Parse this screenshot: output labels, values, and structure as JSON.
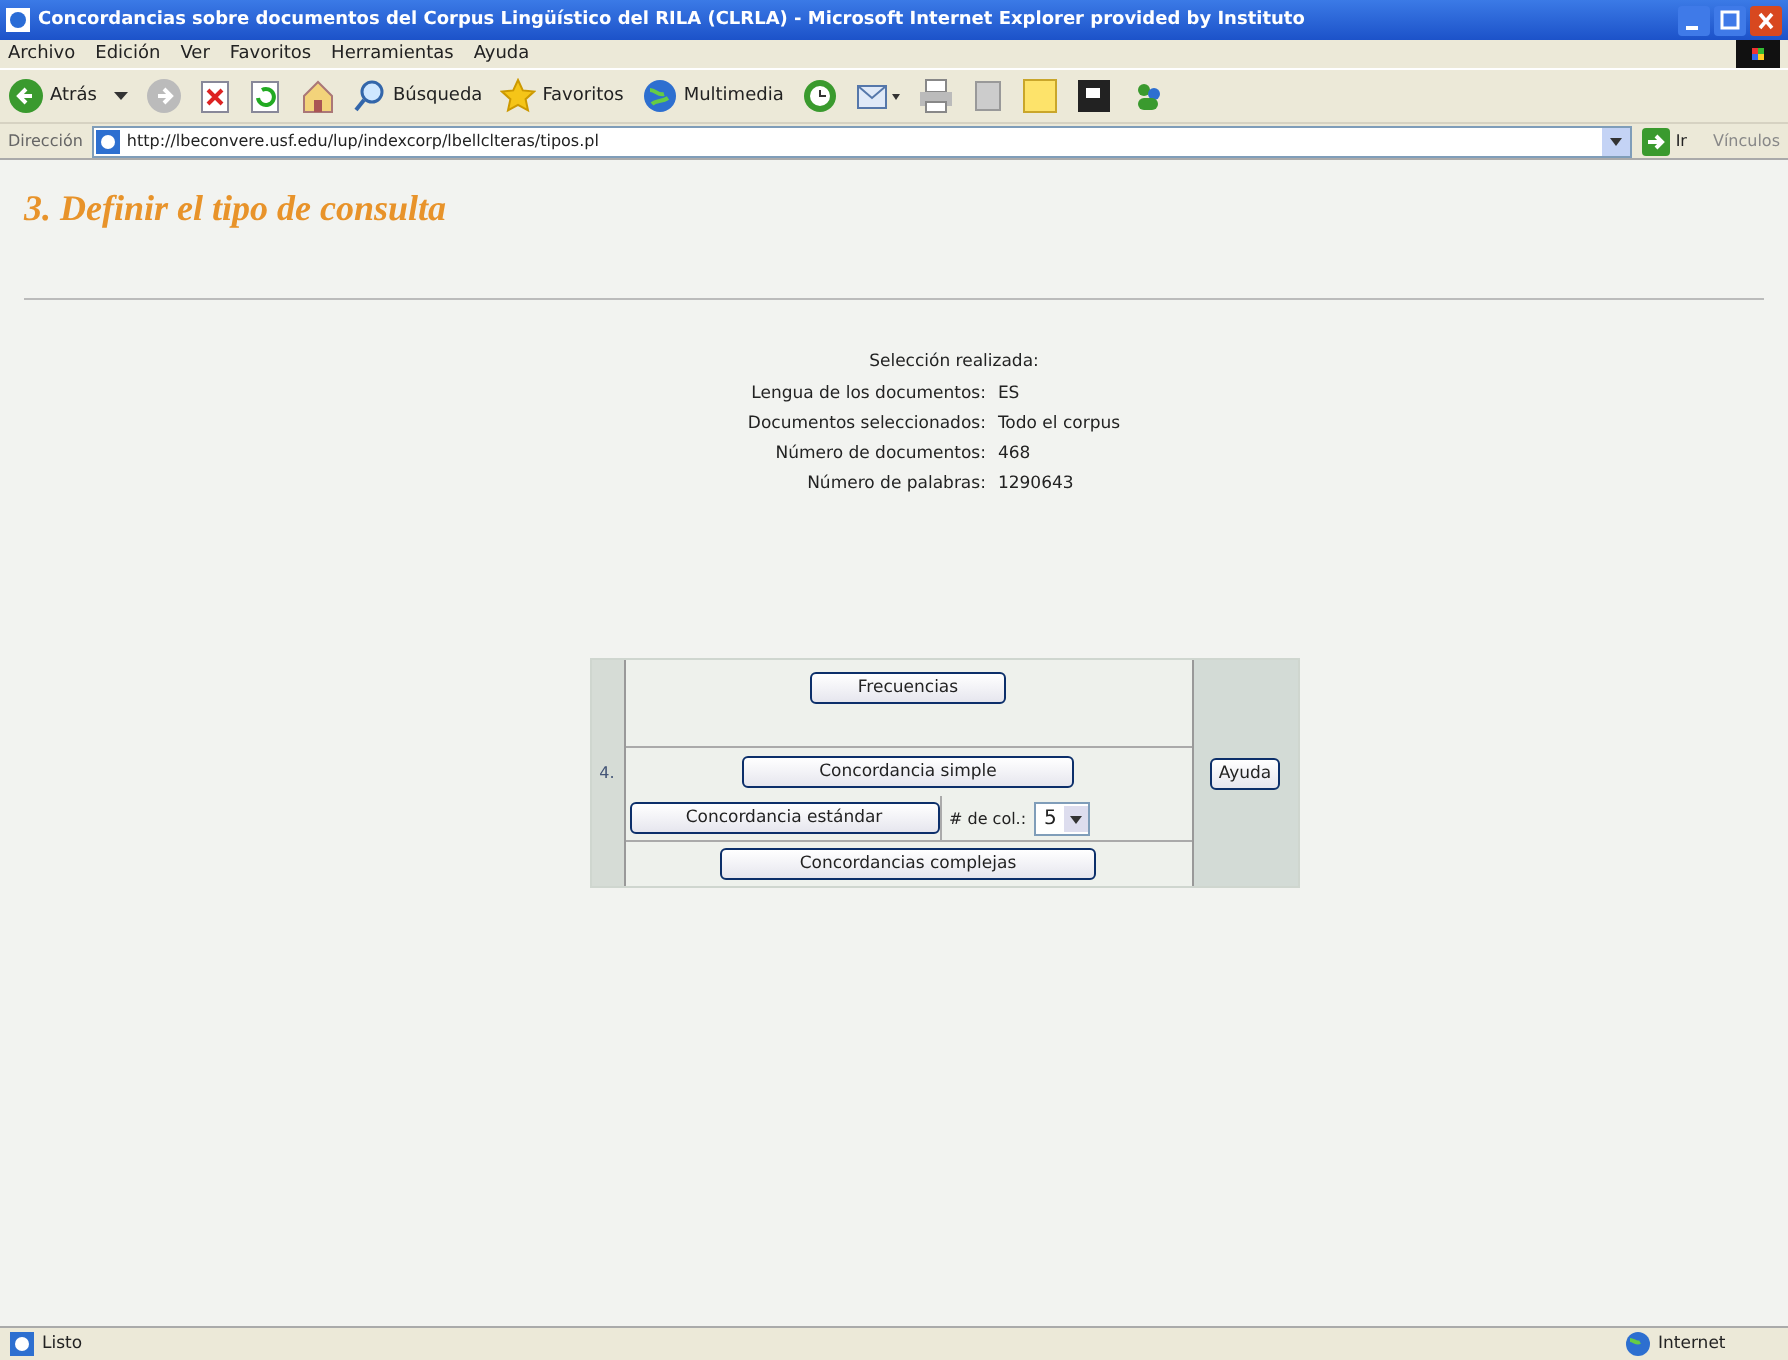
{
  "window": {
    "title": "Concordancias sobre documentos del Corpus Lingüístico del RILA (CLRLA) - Microsoft Internet Explorer provided by Instituto"
  },
  "menu": [
    "Archivo",
    "Edición",
    "Ver",
    "Favoritos",
    "Herramientas",
    "Ayuda"
  ],
  "toolbar": {
    "back": "Atrás",
    "search": "Búsqueda",
    "favorites": "Favoritos",
    "media": "Multimedia"
  },
  "address": {
    "label": "Dirección",
    "value": "http://lbeconvere.usf.edu/lup/indexcorp/lbellclteras/tipos.pl",
    "go": "Ir",
    "links": "Vínculos"
  },
  "page": {
    "number": "3.",
    "heading": "Definir el tipo de consulta",
    "selection_title": "Selección realizada:",
    "selection": [
      {
        "label": "Lengua de los documentos:",
        "value": "ES"
      },
      {
        "label": "Documentos seleccionados:",
        "value": "Todo el corpus"
      },
      {
        "label": "Número de documentos:",
        "value": "468"
      },
      {
        "label": "Número de palabras:",
        "value": "1290643"
      }
    ],
    "step": "4.",
    "buttons": {
      "frequencies": "Frecuencias",
      "simple": "Concordancia simple",
      "standard": "Concordancia estándar",
      "complex": "Concordancias complejas",
      "help": "Ayuda"
    },
    "columns": {
      "label": "# de col.:",
      "value": "5"
    }
  },
  "status_bar": {
    "text": "Listo",
    "zone": "Internet"
  }
}
